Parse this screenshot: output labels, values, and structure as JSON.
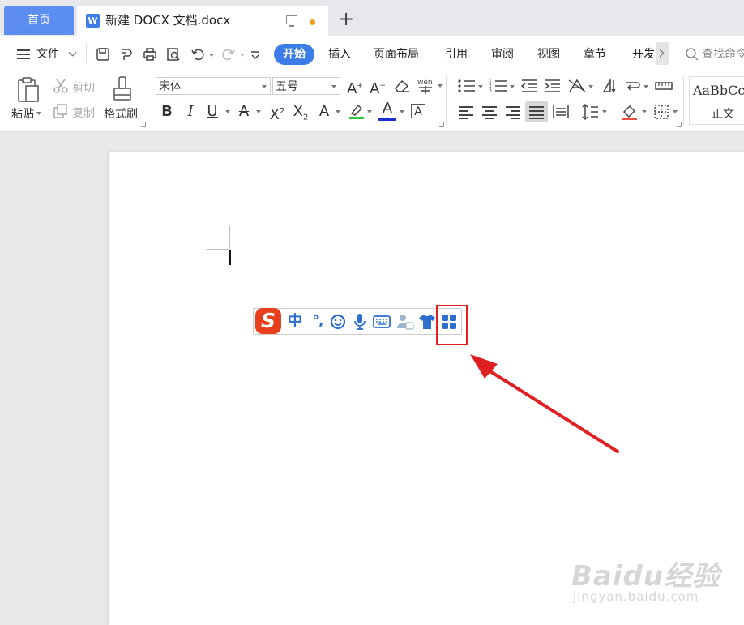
{
  "titlebar": {
    "home_tab": "首页",
    "doc_tab_title": "新建 DOCX 文档.docx",
    "doc_icon_letter": "W",
    "new_tab_symbol": "+"
  },
  "menubar": {
    "file_label": "文件",
    "tabs": [
      "开始",
      "插入",
      "页面布局",
      "引用",
      "审阅",
      "视图",
      "章节",
      "开发"
    ],
    "search_text": "查找命令"
  },
  "ribbon": {
    "paste_label": "粘贴",
    "cut_label": "剪切",
    "copy_label": "复制",
    "format_painter_label": "格式刷",
    "font_name": "宋体",
    "font_size": "五号",
    "style_preview": "AaBbCcI",
    "style_name": "正文"
  },
  "ime": {
    "logo_letter": "S",
    "mode": "中",
    "punct": "°,"
  },
  "watermark": {
    "brand_top": "Baidu经验",
    "brand_url": "jingyan.baidu.com"
  },
  "colors": {
    "accent": "#3b7ce6",
    "home_tab": "#5b8ef0",
    "highlight": "#e02020",
    "ime_logo": "#e8401c"
  }
}
